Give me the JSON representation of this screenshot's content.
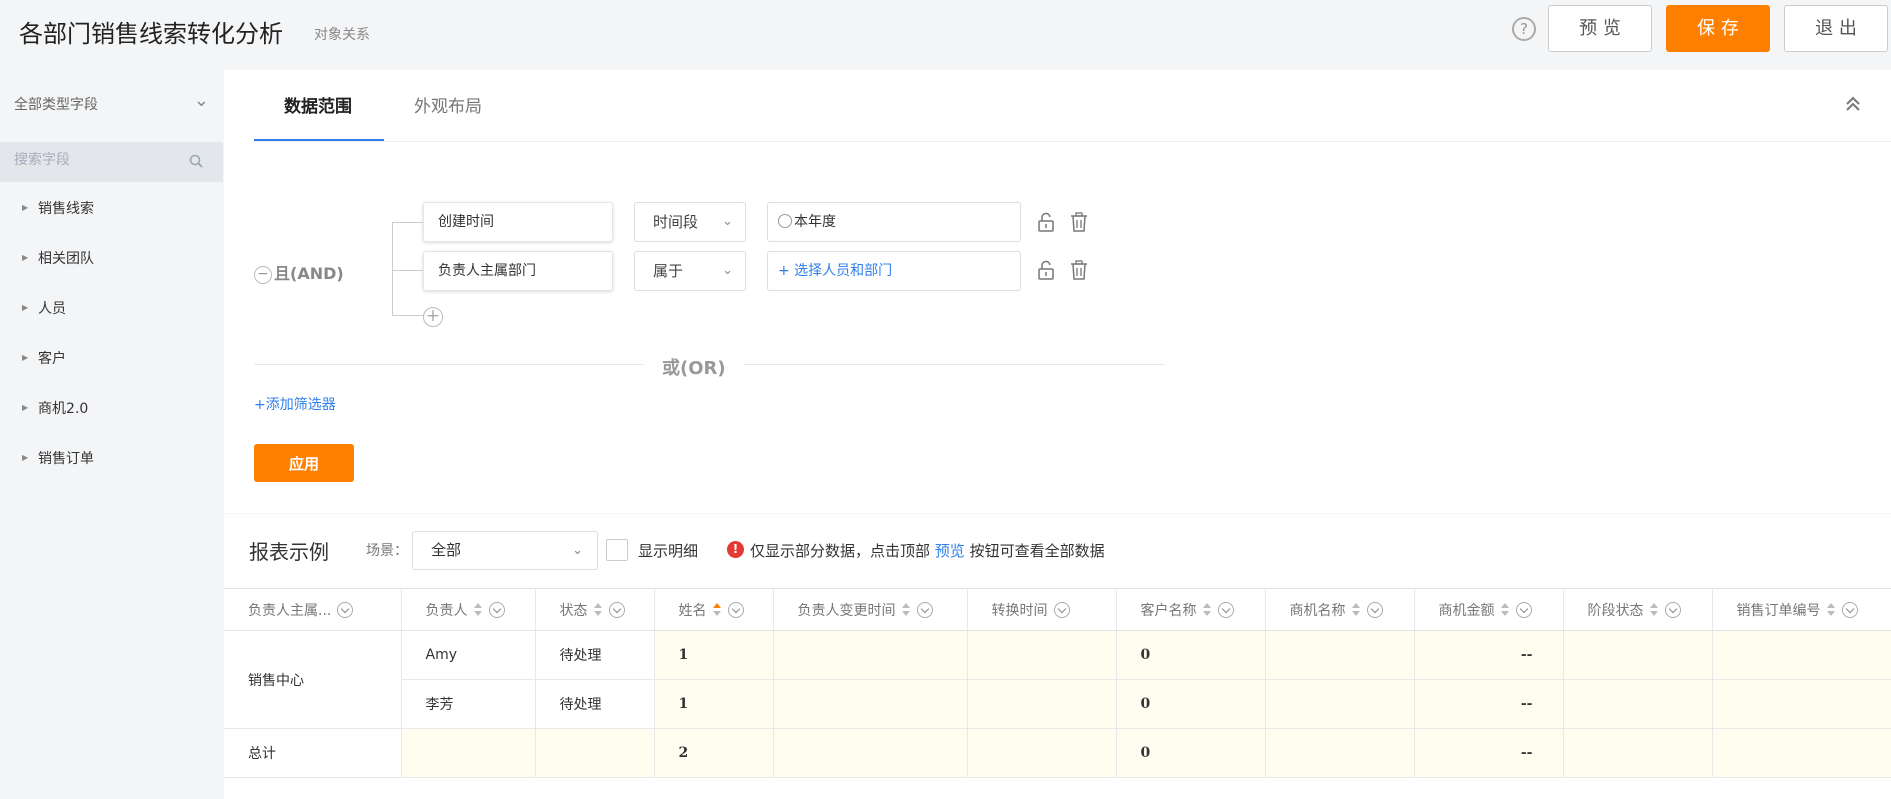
{
  "header": {
    "title": "各部门销售线索转化分析",
    "subtitle": "对象关系",
    "help_label": "?",
    "preview_label": "预 览",
    "save_label": "保 存",
    "exit_label": "退 出",
    "accent_color": "#ff8000"
  },
  "sidebar": {
    "field_type_select": "全部类型字段",
    "search_placeholder": "搜索字段",
    "items": [
      {
        "label": "销售线索"
      },
      {
        "label": "相关团队"
      },
      {
        "label": "人员"
      },
      {
        "label": "客户"
      },
      {
        "label": "商机2.0"
      },
      {
        "label": "销售订单"
      }
    ]
  },
  "tabs": [
    {
      "label": "数据范围",
      "active": true
    },
    {
      "label": "外观布局",
      "active": false
    }
  ],
  "filter": {
    "and_label": "且(AND)",
    "conditions": [
      {
        "field": "创建时间",
        "operator": "时间段",
        "value": "本年度"
      },
      {
        "field": "负责人主属部门",
        "operator": "属于",
        "value": "+ 选择人员和部门"
      }
    ],
    "or_label": "或(OR)",
    "add_filter_label": "+添加筛选器",
    "apply_label": "应用"
  },
  "report": {
    "title": "报表示例",
    "scene_label": "场景：",
    "scene_value": "全部",
    "show_detail_label": "显示明细",
    "notice_before": "仅显示部分数据，点击顶部 ",
    "notice_link": "预览",
    "notice_after": " 按钮可查看全部数据",
    "columns": [
      {
        "label": "负责人主属...",
        "sortable": false
      },
      {
        "label": "负责人",
        "sortable": true
      },
      {
        "label": "状态",
        "sortable": true
      },
      {
        "label": "姓名",
        "sortable": true,
        "sort": "asc"
      },
      {
        "label": "负责人变更时间",
        "sortable": true
      },
      {
        "label": "转换时间",
        "sortable": false
      },
      {
        "label": "客户名称",
        "sortable": true
      },
      {
        "label": "商机名称",
        "sortable": true
      },
      {
        "label": "商机金额",
        "sortable": true
      },
      {
        "label": "阶段状态",
        "sortable": true
      },
      {
        "label": "销售订单编号",
        "sortable": true
      }
    ],
    "group": "销售中心",
    "rows": [
      {
        "owner": "Amy",
        "status": "待处理",
        "name": "1",
        "change_time": "",
        "convert_time": "",
        "customer": "0",
        "opp_name": "",
        "opp_amount": "--",
        "stage": "",
        "order_no": ""
      },
      {
        "owner": "李芳",
        "status": "待处理",
        "name": "1",
        "change_time": "",
        "convert_time": "",
        "customer": "0",
        "opp_name": "",
        "opp_amount": "--",
        "stage": "",
        "order_no": ""
      }
    ],
    "total": {
      "label": "总计",
      "name": "2",
      "customer": "0",
      "opp_amount": "--"
    }
  }
}
